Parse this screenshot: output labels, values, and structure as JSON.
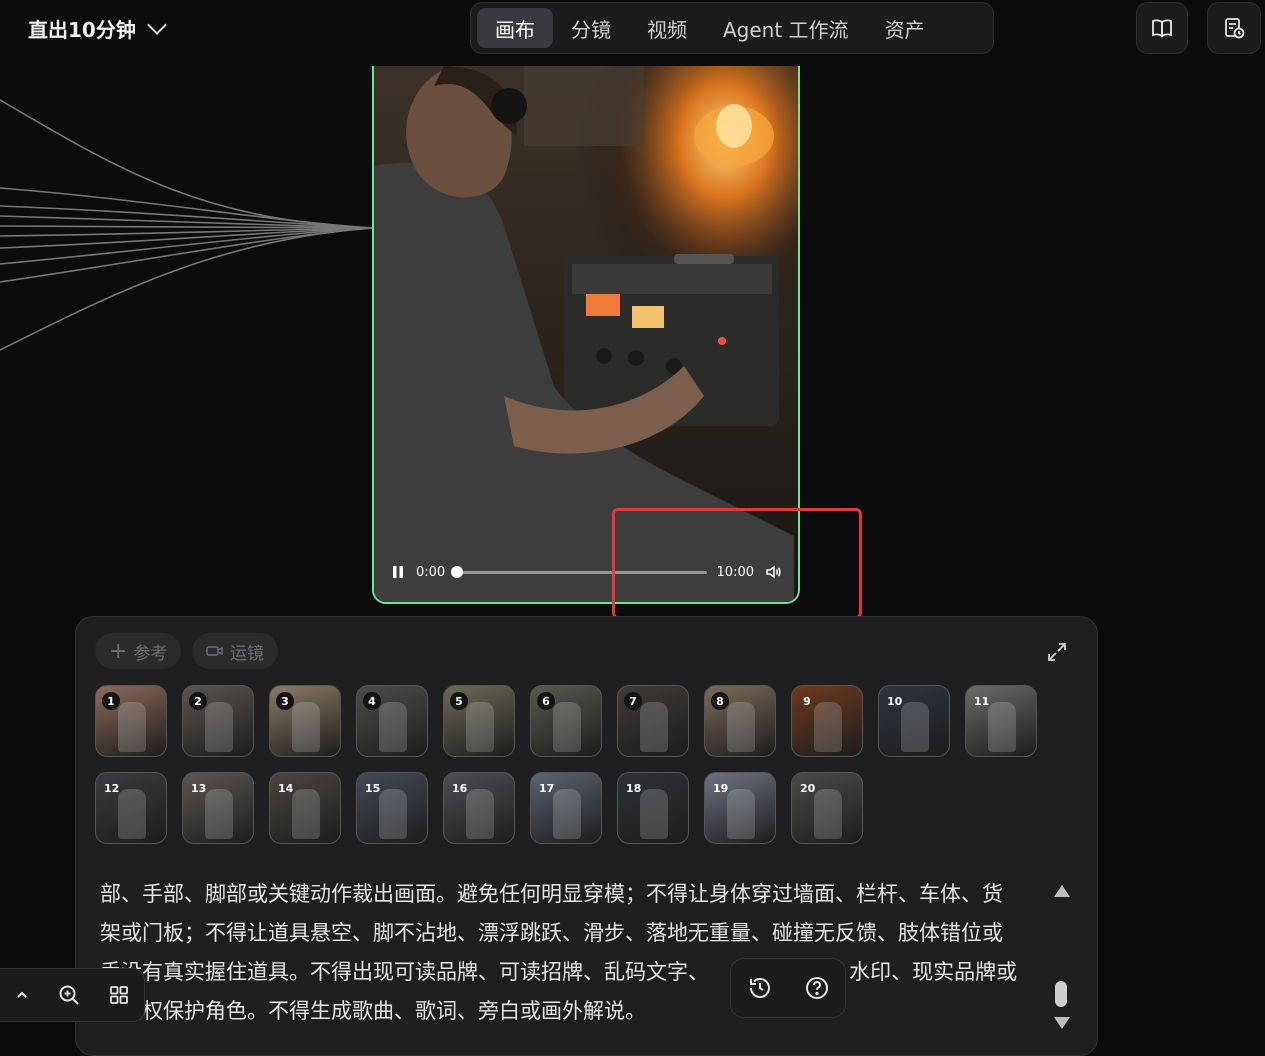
{
  "project": {
    "name": "直出10分钟"
  },
  "tabs": [
    {
      "label": "画布",
      "active": true
    },
    {
      "label": "分镜",
      "active": false
    },
    {
      "label": "视频",
      "active": false
    },
    {
      "label": "Agent 工作流",
      "active": false
    },
    {
      "label": "资产",
      "active": false
    }
  ],
  "header_icons": [
    "book-icon",
    "task-history-icon"
  ],
  "video": {
    "current_time": "0:00",
    "duration": "10:00",
    "progress": 0.0,
    "state": "playing"
  },
  "panel": {
    "chips": [
      {
        "label": "参考",
        "icon": "plus-icon"
      },
      {
        "label": "运镜",
        "icon": "camera-icon"
      }
    ],
    "thumbnails": [
      {
        "n": "1",
        "tone": "#8c6a5a"
      },
      {
        "n": "2",
        "tone": "#5a5450"
      },
      {
        "n": "3",
        "tone": "#8b7b66"
      },
      {
        "n": "4",
        "tone": "#4d4d4a"
      },
      {
        "n": "5",
        "tone": "#6d6a55"
      },
      {
        "n": "6",
        "tone": "#555a4e"
      },
      {
        "n": "7",
        "tone": "#3e3a36"
      },
      {
        "n": "8",
        "tone": "#7a6b58"
      },
      {
        "n": "9",
        "tone": "#6e3a1e"
      },
      {
        "n": "10",
        "tone": "#2e3540"
      },
      {
        "n": "11",
        "tone": "#6a6a68"
      },
      {
        "n": "12",
        "tone": "#3a3b3e"
      },
      {
        "n": "13",
        "tone": "#5b5752"
      },
      {
        "n": "14",
        "tone": "#4a4640"
      },
      {
        "n": "15",
        "tone": "#434a55"
      },
      {
        "n": "16",
        "tone": "#4b4e52"
      },
      {
        "n": "17",
        "tone": "#5b6470"
      },
      {
        "n": "18",
        "tone": "#2e3236"
      },
      {
        "n": "19",
        "tone": "#6d7380"
      },
      {
        "n": "20",
        "tone": "#4a4a48"
      }
    ],
    "prompt_lines": [
      "部、手部、脚部或关键动作裁出画面。避免任何明显穿模；不得让身体穿过墙面、栏杆、车体、货",
      "架或门板；不得让道具悬空、脚不沾地、漂浮跳跃、滑步、落地无重量、碰撞无反馈、肢体错位或",
      "手没有真实握住道具。不得出现可读品牌、可读招牌、乱码文字、                     水印、现实品牌或",
      "受版权保护角色。不得生成歌曲、歌词、旁白或画外解说。"
    ]
  },
  "colors": {
    "video_border": "#6fe59a",
    "highlight": "#e2383a"
  }
}
